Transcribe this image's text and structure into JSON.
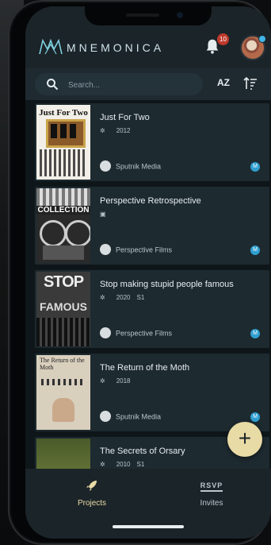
{
  "app": {
    "brand": "MNEMONICA",
    "notifications_count": "10"
  },
  "search": {
    "placeholder": "Search...",
    "sort_label": "AZ"
  },
  "projects": [
    {
      "title": "Just For Two",
      "year": "2012",
      "season": "",
      "company": "Sputnik Media",
      "badge": "M",
      "poster_text": "Just For Two"
    },
    {
      "title": "Perspective Retrospective",
      "year": "",
      "season": "",
      "company": "Perspective Films",
      "badge": "M",
      "poster_text": "COLLECTION"
    },
    {
      "title": "Stop making stupid people famous",
      "year": "2020",
      "season": "S1",
      "company": "Perspective Films",
      "badge": "M",
      "poster_text": "STOP FAMOUS"
    },
    {
      "title": "The Return of the Moth",
      "year": "2018",
      "season": "",
      "company": "Sputnik Media",
      "badge": "M",
      "poster_text": "The Return of the Moth"
    },
    {
      "title": "The Secrets of Orsary",
      "year": "2010",
      "season": "S1",
      "company": "",
      "badge": "",
      "poster_text": ""
    }
  ],
  "fab": {
    "label": "+"
  },
  "tabs": {
    "projects": "Projects",
    "invites": "Invites",
    "invites_icon_text": "RSVP"
  },
  "colors": {
    "accent": "#e9dba6",
    "card_bg": "#1d2a30",
    "badge": "#2f9fd0",
    "notification": "#c0392b"
  }
}
